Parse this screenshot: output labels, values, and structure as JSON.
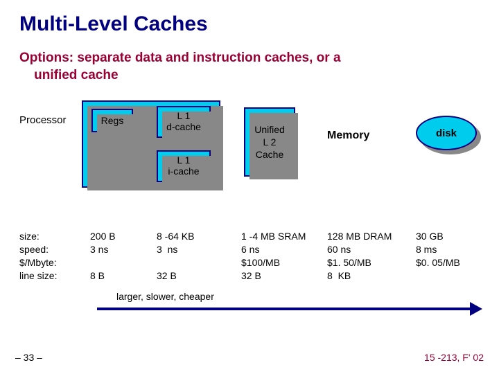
{
  "title": "Multi-Level Caches",
  "subtitle_line1": "Options: separate data and instruction caches, or a",
  "subtitle_line2": "unified cache",
  "labels": {
    "processor": "Processor",
    "regs": "Regs",
    "l1d_l1": "L 1",
    "l1d_l2": "d-cache",
    "l1i_l1": "L 1",
    "l1i_l2": "i-cache",
    "l2_l1": "Unified",
    "l2_l2": "L 2",
    "l2_l3": "Cache",
    "memory": "Memory",
    "disk": "disk"
  },
  "rows": {
    "size": "size:",
    "speed": "speed:",
    "cost": "$/Mbyte:",
    "line": "line size:"
  },
  "cols": {
    "regs": {
      "size": "200 B",
      "speed": "3 ns",
      "cost": "",
      "line": "8 B"
    },
    "l1": {
      "size": "8 -64 KB",
      "speed": "3  ns",
      "cost": "",
      "line": "32 B"
    },
    "l2": {
      "size": "1 -4 MB SRAM",
      "speed": "6 ns",
      "cost": "$100/MB",
      "line": "32 B"
    },
    "memory": {
      "size": "128 MB DRAM",
      "speed": "60 ns",
      "cost": "$1. 50/MB",
      "line": "8  KB"
    },
    "disk": {
      "size": "30 GB",
      "speed": "8 ms",
      "cost": "$0. 05/MB",
      "line": ""
    }
  },
  "arrow_caption": "larger, slower, cheaper",
  "footer_left": "– 33 –",
  "footer_right": "15 -213, F' 02"
}
